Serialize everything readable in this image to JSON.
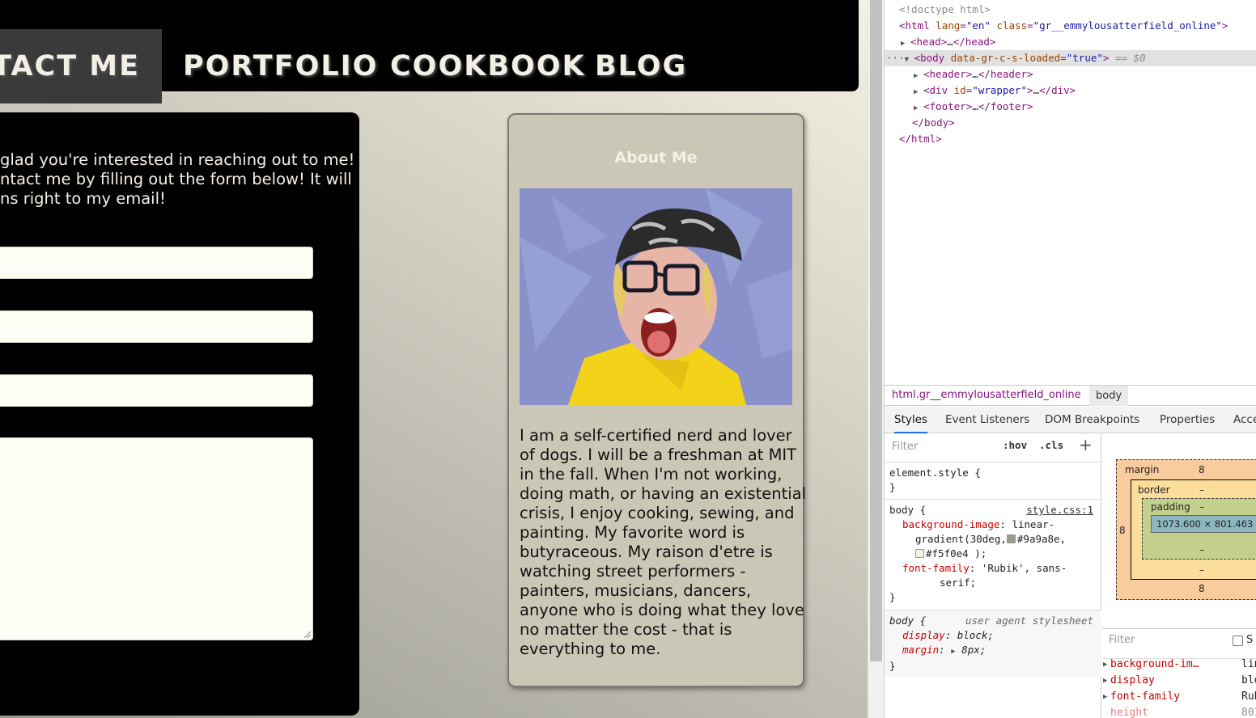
{
  "website": {
    "nav": {
      "active_item": "NTACT ME",
      "items": [
        "PORTFOLIO",
        "COOKBOOK",
        "BLOG"
      ]
    },
    "contact": {
      "intro_lines": [
        "glad you're interested in reaching out to me!",
        "ntact me by filling out the form below! It will",
        "ns right to my email!"
      ]
    },
    "about": {
      "title": "About Me",
      "text_lines": [
        "I am a self-certified nerd and lover",
        "of dogs. I will be a freshman at MIT",
        "in the fall. When I'm not working,",
        "doing math, or having an existential",
        "crisis, I enjoy cooking, sewing, and",
        "painting. My favorite word is",
        "butyraceous. My raison d'etre is",
        "watching street performers -",
        "painters, musicians, dancers,",
        "anyone who is doing what they love",
        "no matter the cost - that is",
        "everything to me."
      ]
    },
    "colors": {
      "nav_bg": "#000000",
      "active_tab_bg": "#3a3a3a",
      "gradient_start": "#9a9a8e",
      "gradient_end": "#f5f0e4",
      "photo_bg": "#8a90c9",
      "shirt": "#f3d21a"
    }
  },
  "devtools": {
    "dom": {
      "doctype": "<!doctype html>",
      "html_open_tag": "html",
      "html_attr1_name": "lang",
      "html_attr1_value": "\"en\"",
      "html_attr2_name": "class",
      "html_attr2_value": "\"gr__emmylousatterfield_online\"",
      "head": "head",
      "body_tag": "body",
      "body_attr_name": "data-gr-c-s-loaded",
      "body_attr_value": "\"true\"",
      "body_suffix": "== $0",
      "ellipsis": "…",
      "header": "header",
      "div": "div",
      "div_attr_name": "id",
      "div_attr_value": "\"wrapper\"",
      "footer": "footer",
      "body_close": "</body>",
      "html_close": "</html>"
    },
    "breadcrumbs": [
      "html.gr__emmylousatterfield_online",
      "body"
    ],
    "tabs": [
      "Styles",
      "Event Listeners",
      "DOM Breakpoints",
      "Properties",
      "Acce"
    ],
    "styles": {
      "filter_placeholder": "Filter",
      "hov": ":hov",
      "cls": ".cls",
      "plus": "+",
      "element_style": "element.style {",
      "close_brace": "}",
      "rule1_selector": "body {",
      "rule1_source": "style.css:1",
      "rule1_prop1": "background-image",
      "rule1_val1a": "linear-",
      "rule1_val1b": "gradient(30deg,",
      "rule1_color1": "#9a9a8e",
      "rule1_color2": "#f5f0e4",
      "rule1_val1c": ");",
      "rule1_prop2": "font-family",
      "rule1_val2a": "'Rubik', sans-",
      "rule1_val2b": "serif;",
      "rule2_selector": "body {",
      "rule2_source": "user agent stylesheet",
      "rule2_prop1": "display",
      "rule2_val1": "block;",
      "rule2_prop2": "margin",
      "rule2_val2": "8px;"
    },
    "box_model": {
      "margin_label": "margin",
      "margin_value": "8",
      "border_label": "border",
      "border_value": "–",
      "padding_label": "padding",
      "padding_value": "–",
      "content_size": "1073.600 × 801.463",
      "left_margin": "8",
      "bottom_margin": "8"
    },
    "computed": {
      "filter_placeholder": "Filter",
      "show_all": "S",
      "rows": [
        {
          "prop": "background-im…",
          "value": "lin"
        },
        {
          "prop": "display",
          "value": "blo"
        },
        {
          "prop": "font-family",
          "value": "Rub"
        },
        {
          "prop": "height",
          "value": "801"
        }
      ]
    }
  }
}
